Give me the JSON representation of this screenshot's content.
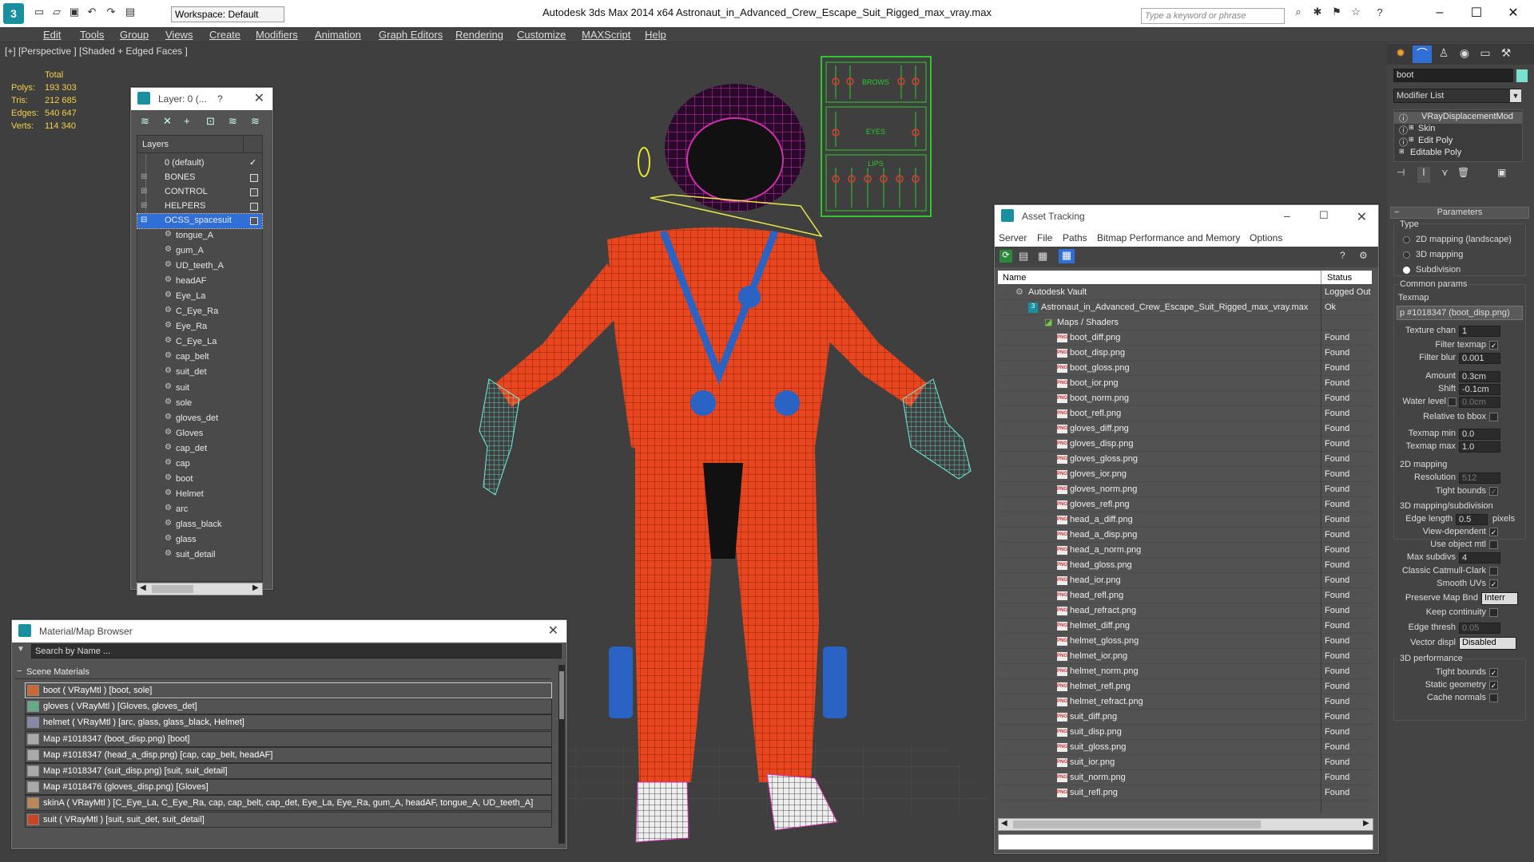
{
  "app": {
    "title": "Autodesk 3ds Max  2014 x64      Astronaut_in_Advanced_Crew_Escape_Suit_Rigged_max_vray.max",
    "workspace": "Workspace: Default",
    "search_placeholder": "Type a keyword or phrase"
  },
  "menu": [
    "Edit",
    "Tools",
    "Group",
    "Views",
    "Create",
    "Modifiers",
    "Animation",
    "Graph Editors",
    "Rendering",
    "Customize",
    "MAXScript",
    "Help"
  ],
  "viewport": {
    "label": "[+] [Perspective ] [Shaded + Edged Faces ]",
    "stats": {
      "header": "Total",
      "rows": [
        {
          "label": "Polys:",
          "value": "193 303"
        },
        {
          "label": "Tris:",
          "value": "212 685"
        },
        {
          "label": "Edges:",
          "value": "540 647"
        },
        {
          "label": "Verts:",
          "value": "114 340"
        }
      ]
    },
    "face_rig_labels": [
      "BROWS",
      "EYES",
      "LIPS"
    ]
  },
  "layer_panel": {
    "title": "Layer: 0 (...",
    "help": "?",
    "header": "Layers",
    "layers": [
      {
        "label": "0 (default)",
        "checked": true
      },
      {
        "label": "BONES",
        "checked": false
      },
      {
        "label": "CONTROL",
        "checked": false
      },
      {
        "label": "HELPERS",
        "checked": false
      },
      {
        "label": "OCSS_spacesuit",
        "checked": false,
        "selected": true
      }
    ],
    "objects": [
      "tongue_A",
      "gum_A",
      "UD_teeth_A",
      "headAF",
      "Eye_La",
      "C_Eye_Ra",
      "Eye_Ra",
      "C_Eye_La",
      "cap_belt",
      "suit_det",
      "suit",
      "sole",
      "gloves_det",
      "Gloves",
      "cap_det",
      "cap",
      "boot",
      "Helmet",
      "arc",
      "glass_black",
      "glass",
      "suit_detail"
    ]
  },
  "material_browser": {
    "title": "Material/Map Browser",
    "search_placeholder": "Search by Name ...",
    "group": "Scene Materials",
    "items": [
      "boot  ( VRayMtl ) [boot, sole]",
      "gloves  ( VRayMtl ) [Gloves, gloves_det]",
      "helmet  ( VRayMtl ) [arc, glass, glass_black, Helmet]",
      "Map #1018347 (boot_disp.png) [boot]",
      "Map #1018347 (head_a_disp.png) [cap, cap_belt, headAF]",
      "Map #1018347 (suit_disp.png) [suit, suit_detail]",
      "Map #1018476 (gloves_disp.png) [Gloves]",
      "skinA  ( VRayMtl ) [C_Eye_La, C_Eye_Ra, cap, cap_belt, cap_det, Eye_La, Eye_Ra, gum_A, headAF, tongue_A, UD_teeth_A]",
      "suit  ( VRayMtl ) [suit, suit_det, suit_detail]"
    ]
  },
  "asset_tracking": {
    "title": "Asset Tracking",
    "menu": [
      "Server",
      "File",
      "Paths",
      "Bitmap Performance and Memory",
      "Options"
    ],
    "col_name": "Name",
    "col_status": "Status",
    "vault": {
      "name": "Autodesk Vault",
      "status": "Logged Out"
    },
    "file": {
      "name": "Astronaut_in_Advanced_Crew_Escape_Suit_Rigged_max_vray.max",
      "status": "Ok"
    },
    "group": "Maps / Shaders",
    "found": "Found",
    "maps": [
      "boot_diff.png",
      "boot_disp.png",
      "boot_gloss.png",
      "boot_ior.png",
      "boot_norm.png",
      "boot_refl.png",
      "gloves_diff.png",
      "gloves_disp.png",
      "gloves_gloss.png",
      "gloves_ior.png",
      "gloves_norm.png",
      "gloves_refl.png",
      "head_a_diff.png",
      "head_a_disp.png",
      "head_a_norm.png",
      "head_gloss.png",
      "head_ior.png",
      "head_refl.png",
      "head_refract.png",
      "helmet_diff.png",
      "helmet_gloss.png",
      "helmet_ior.png",
      "helmet_norm.png",
      "helmet_refl.png",
      "helmet_refract.png",
      "suit_diff.png",
      "suit_disp.png",
      "suit_gloss.png",
      "suit_ior.png",
      "suit_norm.png",
      "suit_refl.png"
    ]
  },
  "command_panel": {
    "object_name": "boot",
    "modifier_list": "Modifier List",
    "stack": [
      "VRayDisplacementMod",
      "Skin",
      "Edit Poly",
      "Editable Poly"
    ],
    "rollout": "Parameters",
    "type_label": "Type",
    "type_options": [
      "2D mapping (landscape)",
      "3D mapping",
      "Subdivision"
    ],
    "common_params": "Common params",
    "texmap_label": "Texmap",
    "texmap_value": "p #1018347 (boot_disp.png)",
    "texture_chan": {
      "label": "Texture chan",
      "value": "1"
    },
    "filter_texmap": "Filter texmap",
    "filter_blur": {
      "label": "Filter blur",
      "value": "0.001"
    },
    "amount": {
      "label": "Amount",
      "value": "0.3cm"
    },
    "shift": {
      "label": "Shift",
      "value": "-0.1cm"
    },
    "water_level": {
      "label": "Water level",
      "value": "0.0cm"
    },
    "relative_bbox": "Relative to bbox",
    "texmap_min": {
      "label": "Texmap min",
      "value": "0.0"
    },
    "texmap_max": {
      "label": "Texmap max",
      "value": "1.0"
    },
    "mapping2d": "2D mapping",
    "resolution": {
      "label": "Resolution",
      "value": "512"
    },
    "tight_bounds": "Tight bounds",
    "mapping3d": "3D mapping/subdivision",
    "edge_length": {
      "label": "Edge length",
      "value": "0.5",
      "unit": "pixels"
    },
    "view_dependent": "View-dependent",
    "use_object_mtl": "Use object mtl",
    "max_subdivs": {
      "label": "Max subdivs",
      "value": "4"
    },
    "classic_catmull": "Classic Catmull-Clark",
    "smooth_uvs": "Smooth UVs",
    "preserve_map": {
      "label": "Preserve Map Bnd",
      "value": "Interr"
    },
    "keep_continuity": "Keep continuity",
    "edge_thresh": {
      "label": "Edge thresh",
      "value": "0.05"
    },
    "vector_displ": {
      "label": "Vector displ",
      "value": "Disabled"
    },
    "performance": "3D performance",
    "perf_tight_bounds": "Tight bounds",
    "static_geometry": "Static geometry",
    "cache_normals": "Cache normals"
  },
  "colors": {
    "accent": "#1a8fa0",
    "suit": "#e8461e",
    "helmet": "#c81fa8",
    "rig": "#2ec82e",
    "selection": "#2f6fd6"
  }
}
